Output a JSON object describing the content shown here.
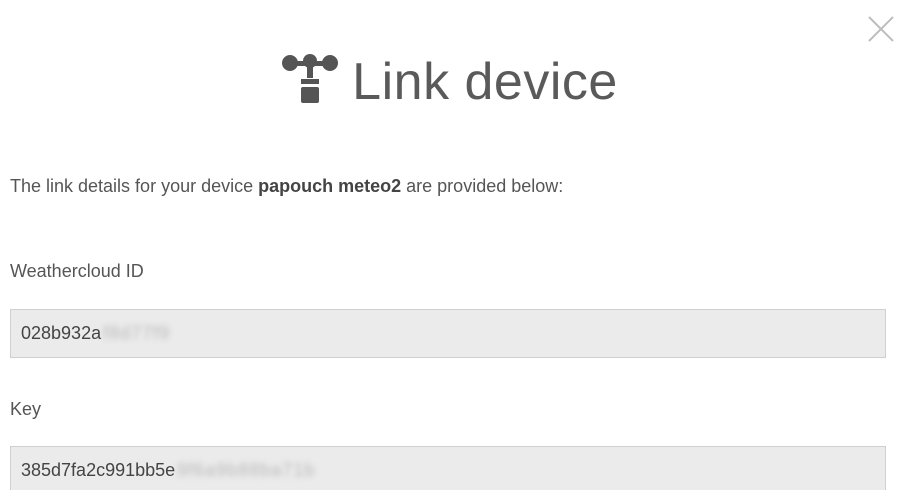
{
  "dialog": {
    "title": "Link device",
    "icon": "anemometer-icon",
    "close_icon": "close-icon"
  },
  "description": {
    "prefix": "The link details for your device ",
    "device_name": "papouch meteo2",
    "suffix": " are provided below:"
  },
  "fields": {
    "weathercloud_id": {
      "label": "Weathercloud ID",
      "value_visible": "028b932a",
      "value_obscured": "f8d77f9"
    },
    "key": {
      "label": "Key",
      "value_visible": "385d7fa2c991bb5e",
      "value_obscured": "9f6a9b88ba71b"
    }
  },
  "colors": {
    "text": "#555555",
    "field_background": "#ebebeb",
    "field_border": "#cfcfcf",
    "icon": "#555555"
  }
}
